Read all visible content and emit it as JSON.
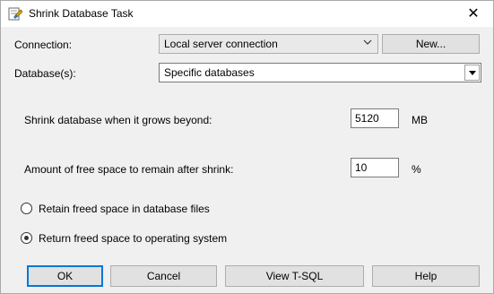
{
  "window": {
    "title": "Shrink Database Task",
    "close_glyph": "✕"
  },
  "form": {
    "connection_label": "Connection:",
    "connection_value": "Local server connection",
    "new_button": "New...",
    "database_label": "Database(s):",
    "database_value": "Specific databases",
    "shrink_label": "Shrink database when it grows beyond:",
    "shrink_value": "5120",
    "shrink_unit": "MB",
    "free_space_label": "Amount of free space to remain after shrink:",
    "free_space_value": "10",
    "free_space_unit": "%",
    "radio_retain_label": "Retain freed space in database files",
    "radio_return_label": "Return freed space to operating system",
    "selected_option": "return"
  },
  "buttons": {
    "ok": "OK",
    "cancel": "Cancel",
    "view_tsql": "View T-SQL",
    "help": "Help"
  },
  "colors": {
    "dialog_bg": "#f0f0f0",
    "focus_border": "#0078d7"
  }
}
